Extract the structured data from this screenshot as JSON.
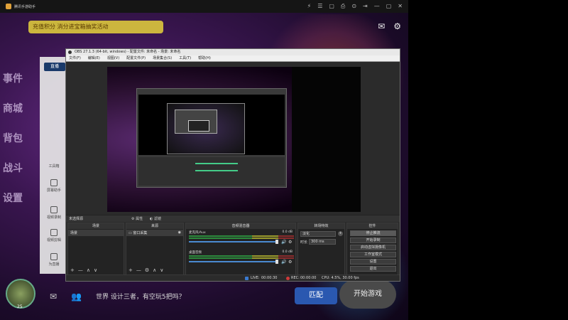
{
  "emulator": {
    "title": "腾讯手游助手",
    "banner_text": "充值积分 消分进宝箱抽奖活动",
    "left_menu": [
      "事件",
      "商城",
      "背包",
      "战斗",
      "设置"
    ],
    "bottom_text": "世界 设计三者，有空玩5把吗？",
    "match_label": "匹配",
    "start_label": "开始游戏",
    "avatar_level": "25",
    "window_controls": [
      "⚡",
      "☰",
      "▢",
      "⎙",
      "⊙",
      "⇥",
      "—",
      "▢",
      "✕"
    ]
  },
  "side_panel": {
    "logo": "直播",
    "items": [
      {
        "label": "工具箱"
      },
      {
        "label": "屏幕助手"
      },
      {
        "label": "视频录制"
      },
      {
        "label": "视频剪辑"
      },
      {
        "label": "为直播"
      }
    ]
  },
  "obs": {
    "title": "OBS 27.1.3 (64-bit, windows) - 配置文件: 未命名 - 场景: 未命名",
    "menu": [
      "文件(F)",
      "编辑(E)",
      "视图(V)",
      "配置文件(P)",
      "场景集合(S)",
      "工具(T)",
      "帮助(H)"
    ],
    "no_source_selected": "未选择源",
    "properties_label": "属性",
    "filters_label": "滤镜",
    "docks": {
      "scenes": {
        "title": "场景",
        "items": [
          "场景"
        ]
      },
      "sources": {
        "title": "来源",
        "items": [
          "窗口采集"
        ]
      },
      "mixer": {
        "title": "音频混音器",
        "channels": [
          {
            "name": "麦克风/Aux",
            "db": "0.0 dB"
          },
          {
            "name": "桌面音频",
            "db": "0.0 dB"
          }
        ]
      },
      "transitions": {
        "title": "转场特效",
        "selected": "淡化",
        "duration_label": "时长",
        "duration_value": "300 ms"
      },
      "controls": {
        "title": "控件",
        "buttons": [
          "停止推流",
          "开始录制",
          "启动虚拟摄像机",
          "工作室模式",
          "设置",
          "退出"
        ]
      }
    },
    "status": {
      "live_label": "LIVE:",
      "live_time": "00:00:30",
      "rec_label": "REC:",
      "rec_time": "00:00:00",
      "cpu": "CPU: 4.5%, 30.00 fps"
    }
  }
}
